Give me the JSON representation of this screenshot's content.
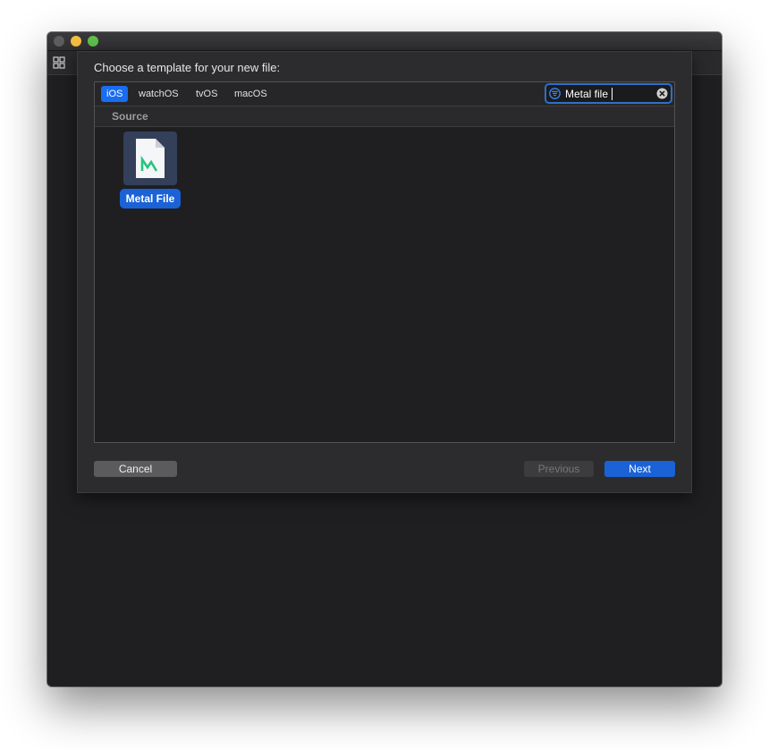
{
  "dialog": {
    "title": "Choose a template for your new file:"
  },
  "platforms": [
    {
      "label": "iOS",
      "selected": true
    },
    {
      "label": "watchOS",
      "selected": false
    },
    {
      "label": "tvOS",
      "selected": false
    },
    {
      "label": "macOS",
      "selected": false
    }
  ],
  "search": {
    "value": "Metal file",
    "icons": {
      "filter": "filter-icon",
      "clear": "clear-circle-icon"
    }
  },
  "section": {
    "label": "Source"
  },
  "templates": [
    {
      "label": "Metal File",
      "icon": "metal-file-icon",
      "selected": true
    }
  ],
  "buttons": {
    "cancel": "Cancel",
    "previous": "Previous",
    "next": "Next"
  },
  "colors": {
    "accent": "#1a62d6",
    "metal_glyph": "#27c47f"
  }
}
